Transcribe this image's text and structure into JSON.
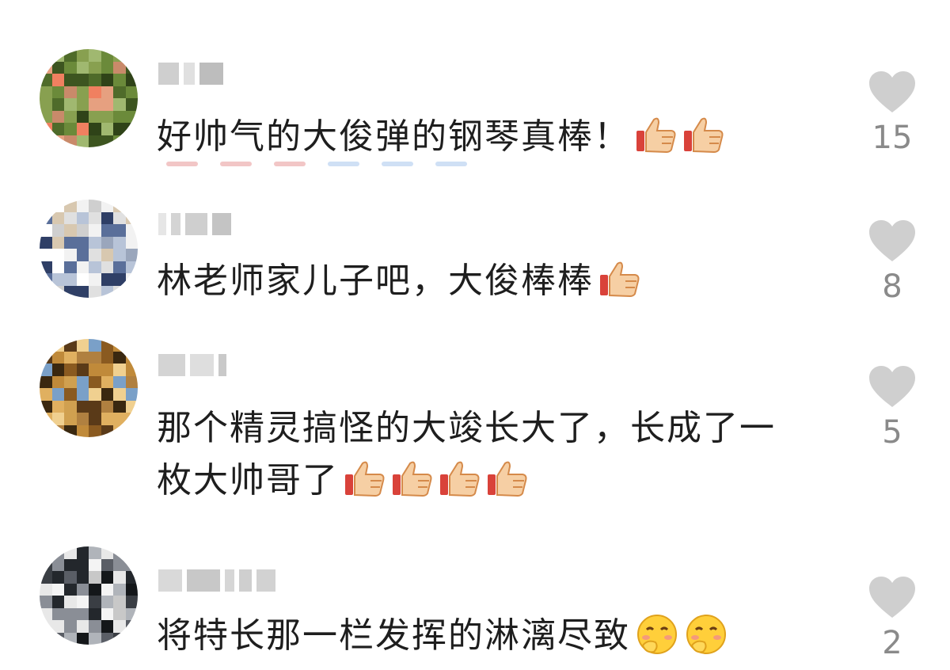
{
  "comments": [
    {
      "text": "好帅气的大俊弹的钢琴真棒！",
      "emoji": [
        "thumbs-up",
        "thumbs-up"
      ],
      "likes": "15"
    },
    {
      "text": "林老师家儿子吧，大俊棒棒",
      "emoji": [
        "thumbs-up"
      ],
      "likes": "8"
    },
    {
      "text": "那个精灵搞怪的大竣长大了，长成了一枚大帅哥了",
      "emoji": [
        "thumbs-up",
        "thumbs-up",
        "thumbs-up",
        "thumbs-up"
      ],
      "likes": "5"
    },
    {
      "text": "将特长那一栏发挥的淋漓尽致",
      "emoji": [
        "shy-face",
        "shy-face"
      ],
      "likes": "2"
    }
  ],
  "icons": {
    "like": "heart-icon",
    "thumbs_up": "thumbs-up-icon",
    "shy_face": "shy-face-icon"
  },
  "colors": {
    "heart": "#cfcfcf",
    "count": "#8a8a8a",
    "text": "#1e1e1e"
  }
}
